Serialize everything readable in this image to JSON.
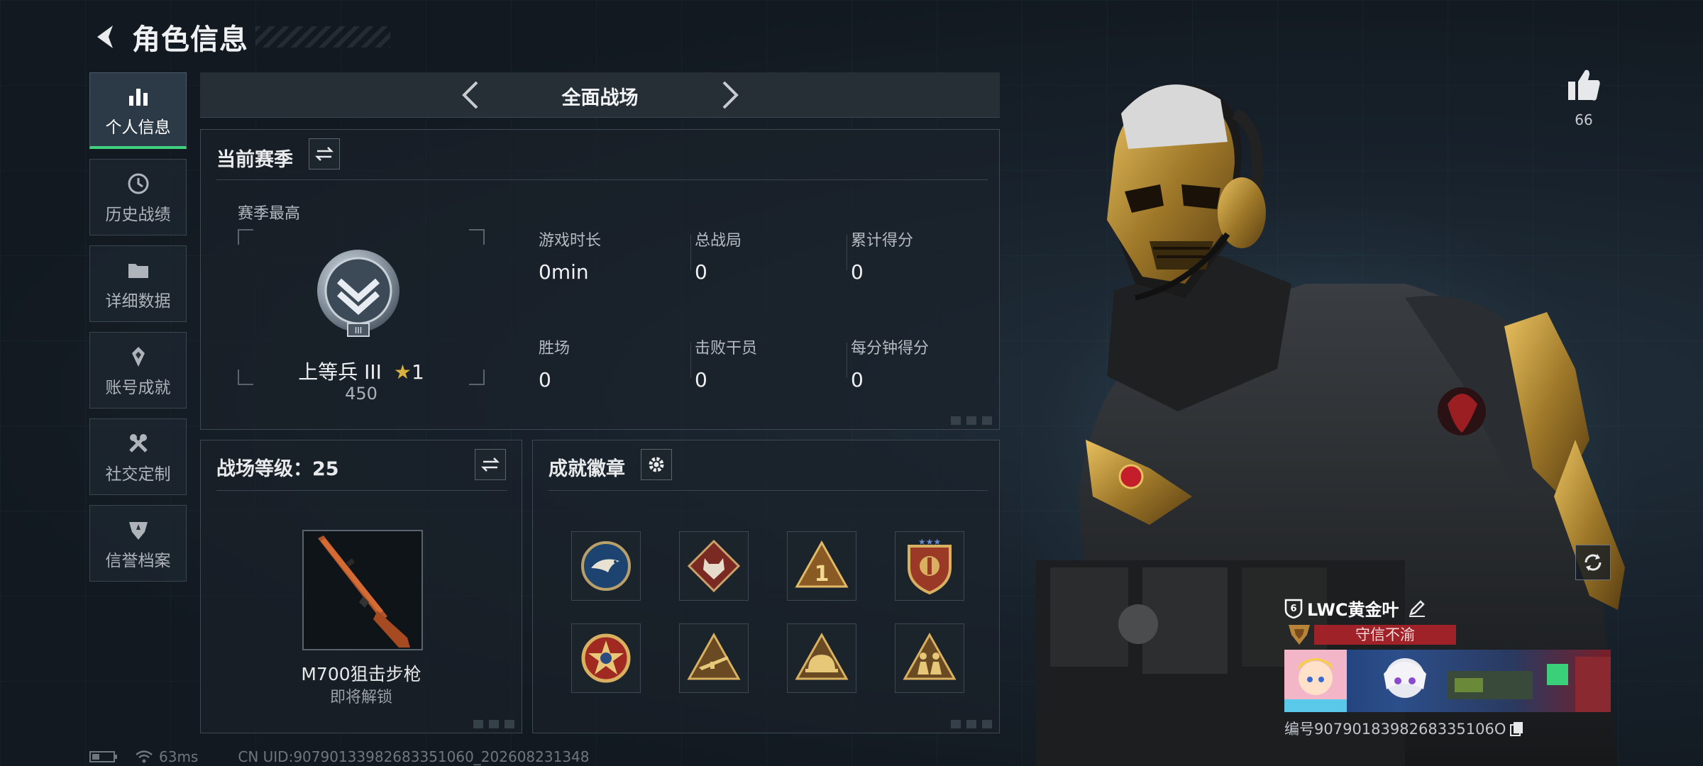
{
  "header": {
    "title": "角色信息"
  },
  "nav": {
    "items": [
      {
        "label": "个人信息",
        "icon": "bar-chart-icon",
        "active": true
      },
      {
        "label": "历史战绩",
        "icon": "history-icon",
        "active": false
      },
      {
        "label": "详细数据",
        "icon": "folder-icon",
        "active": false
      },
      {
        "label": "账号成就",
        "icon": "achievement-icon",
        "active": false
      },
      {
        "label": "社交定制",
        "icon": "tools-icon",
        "active": false
      },
      {
        "label": "信誉档案",
        "icon": "credit-shield-icon",
        "active": false
      }
    ]
  },
  "mode": {
    "title": "全面战场"
  },
  "season": {
    "title": "当前赛季",
    "subtitle": "赛季最高",
    "rank_name": "上等兵 III",
    "rank_stars": "1",
    "rank_points": "450",
    "stats": [
      {
        "label": "游戏时长",
        "value": "0min"
      },
      {
        "label": "总战局",
        "value": "0"
      },
      {
        "label": "累计得分",
        "value": "0"
      },
      {
        "label": "胜场",
        "value": "0"
      },
      {
        "label": "击败干员",
        "value": "0"
      },
      {
        "label": "每分钟得分",
        "value": "0"
      }
    ]
  },
  "battlefield": {
    "title": "战场等级：25",
    "weapon_name": "M700狙击步枪",
    "weapon_status": "即将解锁"
  },
  "achievements": {
    "title": "成就徽章",
    "medals": [
      "eagle-medal-icon",
      "wolf-medal-icon",
      "number-one-medal-icon",
      "shield-medal-icon",
      "star-medal-icon",
      "rifle-medal-icon",
      "helmet-medal-icon",
      "soldiers-medal-icon"
    ]
  },
  "status_bar": {
    "ping": "63ms",
    "uid": "CN UID:907901339826833510​60_202608231348"
  },
  "like": {
    "count": "66"
  },
  "player": {
    "name": "LWC黄金叶",
    "title": "守信不渝",
    "id_label": "编号9079018398268335106O"
  },
  "colors": {
    "accent": "#3fd17f",
    "title_red": "#9e2227"
  }
}
